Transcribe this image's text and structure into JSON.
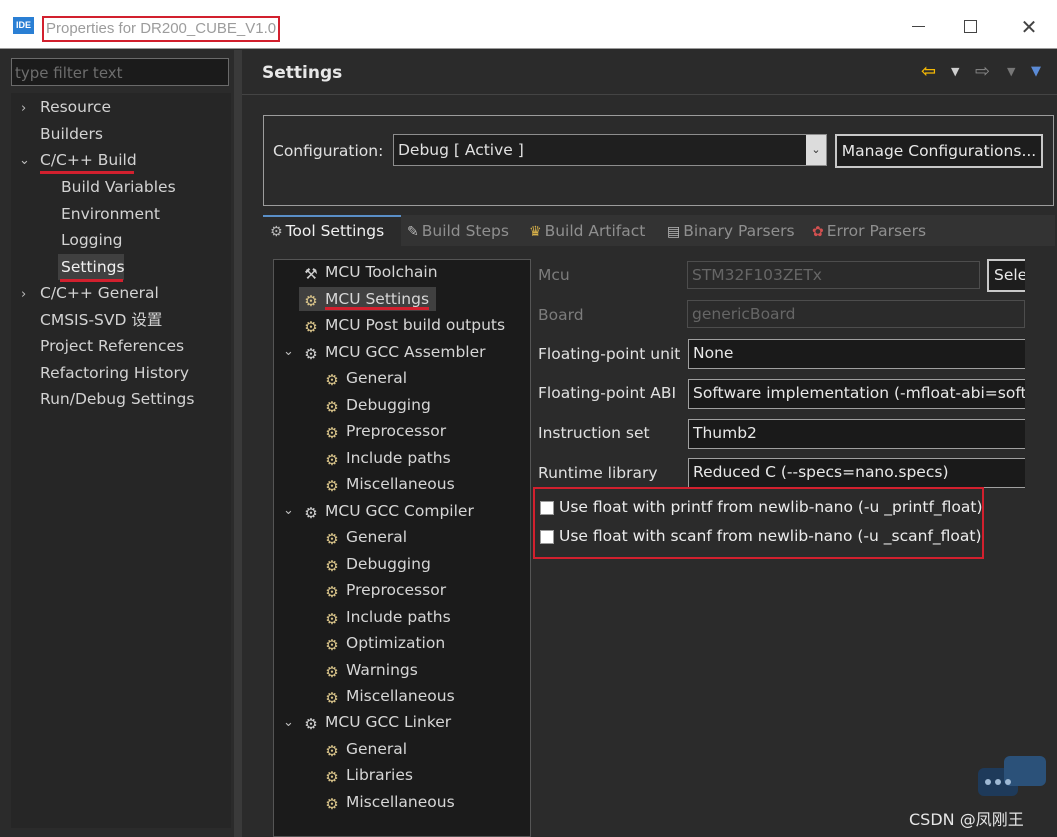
{
  "window": {
    "app_icon_text": "IDE",
    "title": "Properties for DR200_CUBE_V1.0"
  },
  "left": {
    "filter_placeholder": "type filter text",
    "items": [
      {
        "label": "Resource"
      },
      {
        "label": "Builders"
      },
      {
        "label": "C/C++ Build"
      },
      {
        "label": "Build Variables"
      },
      {
        "label": "Environment"
      },
      {
        "label": "Logging"
      },
      {
        "label": "Settings"
      },
      {
        "label": "C/C++ General"
      },
      {
        "label": "CMSIS-SVD 设置"
      },
      {
        "label": "Project References"
      },
      {
        "label": "Refactoring History"
      },
      {
        "label": "Run/Debug Settings"
      }
    ]
  },
  "page": {
    "title": "Settings",
    "configuration_label": "Configuration:",
    "configuration_value": "Debug  [ Active ]",
    "manage_button": "Manage Configurations..."
  },
  "tabs": [
    {
      "label": "Tool Settings",
      "icon": "gear-icon"
    },
    {
      "label": "Build Steps",
      "icon": "build-steps-icon"
    },
    {
      "label": "Build Artifact",
      "icon": "trophy-icon"
    },
    {
      "label": "Binary Parsers",
      "icon": "binary-parser-icon"
    },
    {
      "label": "Error Parsers",
      "icon": "error-parser-icon"
    }
  ],
  "tool_tree": [
    {
      "label": "MCU Toolchain"
    },
    {
      "label": "MCU Settings"
    },
    {
      "label": "MCU Post build outputs"
    },
    {
      "label": "MCU GCC Assembler"
    },
    {
      "label": "General"
    },
    {
      "label": "Debugging"
    },
    {
      "label": "Preprocessor"
    },
    {
      "label": "Include paths"
    },
    {
      "label": "Miscellaneous"
    },
    {
      "label": "MCU GCC Compiler"
    },
    {
      "label": "General"
    },
    {
      "label": "Debugging"
    },
    {
      "label": "Preprocessor"
    },
    {
      "label": "Include paths"
    },
    {
      "label": "Optimization"
    },
    {
      "label": "Warnings"
    },
    {
      "label": "Miscellaneous"
    },
    {
      "label": "MCU GCC Linker"
    },
    {
      "label": "General"
    },
    {
      "label": "Libraries"
    },
    {
      "label": "Miscellaneous"
    }
  ],
  "props": {
    "mcu_label": "Mcu",
    "mcu_value": "STM32F103ZETx",
    "select_button": "Sele",
    "board_label": "Board",
    "board_value": "genericBoard",
    "fpu_label": "Floating-point unit",
    "fpu_value": "None",
    "fpabi_label": "Floating-point ABI",
    "fpabi_value": "Software implementation (-mfloat-abi=soft)",
    "iset_label": "Instruction set",
    "iset_value": "Thumb2",
    "runtime_label": "Runtime library",
    "runtime_value": "Reduced C (--specs=nano.specs)",
    "printf_float": "Use float with printf from newlib-nano (-u _printf_float)",
    "scanf_float": "Use float with scanf from newlib-nano (-u _scanf_float)"
  },
  "watermark": "CSDN @凤刚王",
  "colors": {
    "highlight_red": "#d2202e",
    "back_arrow": "#f2b705",
    "dropdown_blue": "#5b8bd6"
  }
}
